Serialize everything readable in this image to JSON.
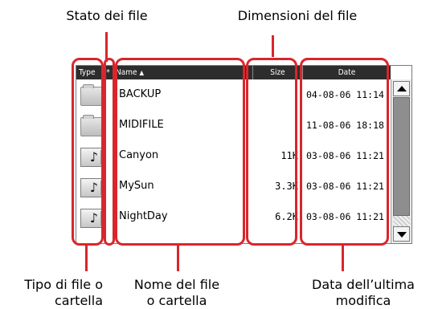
{
  "callouts": {
    "file_state": "Stato dei file",
    "file_size": "Dimensioni del file",
    "type_line1": "Tipo di file o",
    "type_line2": "cartella",
    "name_line1": "Nome del file",
    "name_line2": "o cartella",
    "date_line1": "Data dell’ultima",
    "date_line2": "modifica"
  },
  "header": {
    "type": "Type",
    "status": "*",
    "name": "Name",
    "sort_indicator": "▲",
    "size": "Size",
    "date": "Date"
  },
  "rows": [
    {
      "icon": "folder-icon",
      "name": "BACKUP",
      "size": "",
      "date": "04-08-06 11:14"
    },
    {
      "icon": "folder-icon",
      "name": "MIDIFILE",
      "size": "",
      "date": "11-08-06 18:18"
    },
    {
      "icon": "song-icon",
      "name": "Canyon",
      "size": "11K",
      "date": "03-08-06 11:21"
    },
    {
      "icon": "song-icon",
      "name": "MySun",
      "size": "3.3K",
      "date": "03-08-06 11:21"
    },
    {
      "icon": "song-icon",
      "name": "NightDay",
      "size": "6.2K",
      "date": "03-08-06 11:21"
    }
  ],
  "icons": {
    "song_glyph": "♪"
  },
  "colors": {
    "highlight": "#d8262c",
    "header_bg": "#2d2d2d"
  }
}
